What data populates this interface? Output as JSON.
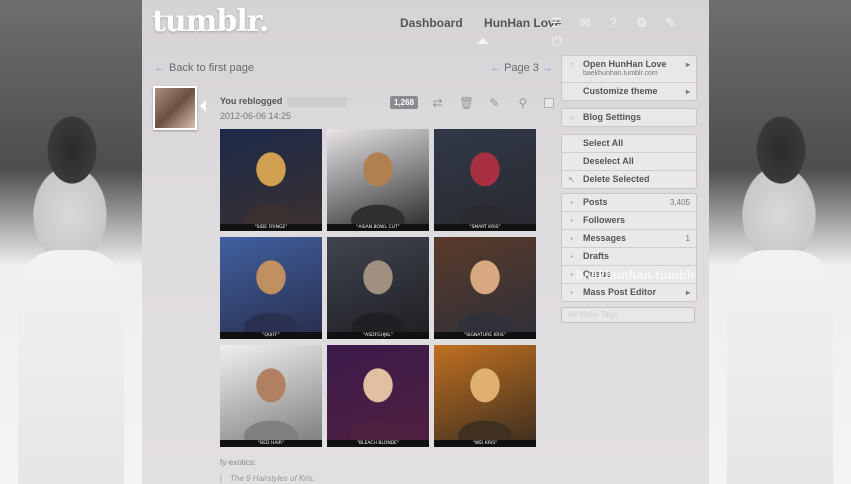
{
  "logo": "tumblr.",
  "nav": {
    "dashboard": "Dashboard",
    "blog": "HunHan Love"
  },
  "top_icons": [
    "list-icon",
    "mail-icon",
    "help-icon",
    "gear-icon",
    "pen-icon",
    "power-icon"
  ],
  "back_link": "Back to first page",
  "page_label": "Page 3",
  "post": {
    "action": "You reblogged",
    "date": "2012-06-06 14:25",
    "notes": "1,268",
    "source": "fy-exotics:",
    "quote": "The 9 Hairstyles of Kris."
  },
  "tiles": [
    {
      "caption": "\"SIDE FRINGE\"",
      "bg": [
        "#1c2a4a",
        "#d0a050",
        "#3a3030"
      ]
    },
    {
      "caption": "\"ASIAN BOWL CUT\"",
      "bg": [
        "#e8e4e8",
        "#b08050",
        "#303030"
      ]
    },
    {
      "caption": "\"SMART KRIS\"",
      "bg": [
        "#303848",
        "#a83040",
        "#2a2a30"
      ]
    },
    {
      "caption": "\"QUIFF\"",
      "bg": [
        "#4060a0",
        "#c09060",
        "#2a3050"
      ]
    },
    {
      "caption": "\"ASDFGHJKL\"",
      "bg": [
        "#404450",
        "#a09080",
        "#202024"
      ]
    },
    {
      "caption": "\"SIGNATURE KRIS\"",
      "bg": [
        "#5a3a2a",
        "#d8a880",
        "#303038"
      ]
    },
    {
      "caption": "\"BED HAIR\"",
      "bg": [
        "#f0f0f0",
        "#b08060",
        "#808080"
      ]
    },
    {
      "caption": "\"BLEACH BLONDE\"",
      "bg": [
        "#3a1a4a",
        "#e0c0a0",
        "#502040"
      ]
    },
    {
      "caption": "\"WEI KRIS\"",
      "bg": [
        "#c07020",
        "#e0b070",
        "#403020"
      ]
    }
  ],
  "sidebar": {
    "blog_group": {
      "open_label": "Open HunHan Love",
      "blog_url": "baekhunhan.tumblr.com",
      "customize_label": "Customize theme"
    },
    "settings_label": "Blog Settings",
    "select_group": {
      "select_all": "Select All",
      "deselect_all": "Deselect All",
      "delete_selected": "Delete Selected"
    },
    "stats": [
      {
        "label": "Posts",
        "count": "3,405"
      },
      {
        "label": "Followers",
        "count": ""
      },
      {
        "label": "Messages",
        "count": "1"
      },
      {
        "label": "Drafts",
        "count": ""
      },
      {
        "label": "Queue",
        "count": ""
      },
      {
        "label": "Mass Post Editor",
        "count": ""
      }
    ],
    "tags_placeholder": "All Mass Tags"
  },
  "watermark": "baekhunhan.tumblr"
}
